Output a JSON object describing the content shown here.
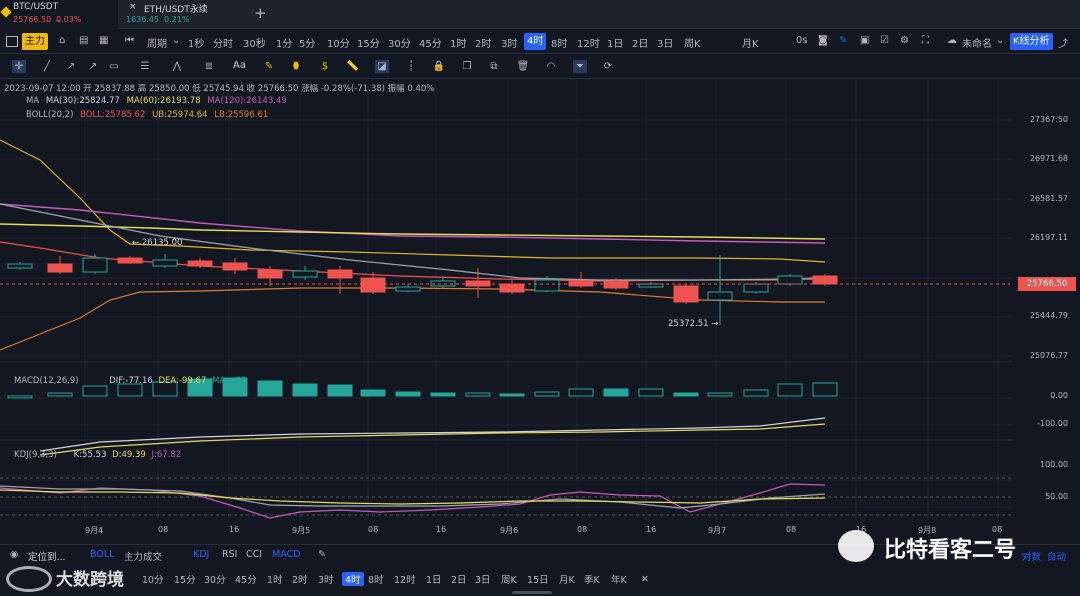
{
  "tabs": [
    {
      "symbol": "BTC/USDT",
      "price": "25766.50",
      "change": "0.03%"
    },
    {
      "symbol": "ETH/USDT永续",
      "price": "1636.45",
      "change": "0.21%"
    }
  ],
  "toolbar": {
    "main_label": "主力",
    "period_label": "周期",
    "intervals": [
      "1秒",
      "分时",
      "30秒",
      "1分",
      "5分",
      "10分",
      "15分",
      "30分",
      "45分",
      "1时",
      "2时",
      "3时",
      "4时",
      "8时",
      "12时",
      "1日",
      "2日",
      "3日",
      "周K",
      "月K"
    ],
    "active_interval": "4时",
    "zero_s": "0s",
    "unnamed": "未命名",
    "kline_btn": "K线分析"
  },
  "draw_tools": {
    "text_tool": "Aa"
  },
  "ohlc_line": "2023-09-07 12:00  开 25837.88  高 25850.00  低 25745.94  收 25766.50  涨幅 -0.28%(-71.38)  振幅 0.40%",
  "ma_legend": {
    "label": "MA",
    "ma30": "MA(30):25824.77",
    "ma60": "MA(60):26193.78",
    "ma120": "MA(120):26143.49"
  },
  "boll_legend": {
    "label": "BOLL(20,2)",
    "mid": "BOLL:25785.62",
    "ub": "UB:25974.64",
    "lb": "LB:25596.61"
  },
  "price_axis": [
    "27367.50",
    "26971.68",
    "26581.57",
    "26197.11",
    "25766.50",
    "25444.79",
    "25076.77"
  ],
  "current_price": "25766.50",
  "high_marker": "← 26135.00",
  "low_marker": "25372.51 →",
  "macd_legend": {
    "label": "MACD(12,26,9)",
    "dif": "DIF:-77.16",
    "dea": "DEA:-99.67",
    "macd_tail": "MA",
    "macd_value": "02"
  },
  "macd_axis": [
    "0.00",
    "-100.00"
  ],
  "kdj_legend": {
    "label": "KDJ(9,3,3)",
    "k": "K:55.53",
    "d": "D:49.39",
    "j": "J:67.82"
  },
  "kdj_axis": [
    "100.00",
    "50.00"
  ],
  "x_axis": [
    "9月4",
    "08",
    "16",
    "9月5",
    "08",
    "16",
    "9月6",
    "08",
    "16",
    "9月7",
    "08",
    "16",
    "9月8",
    "08"
  ],
  "bottom": {
    "locate": "定位到...",
    "boll": "BOLL",
    "main": "主力成交",
    "kdj": "KDJ",
    "rsi": "RSI",
    "cci": "CCI",
    "macd": "MACD",
    "intervals": [
      "10分",
      "15分",
      "30分",
      "45分",
      "1时",
      "2时",
      "3时",
      "4时",
      "8时",
      "12时",
      "1日",
      "2日",
      "3日",
      "周K",
      "15日",
      "月K",
      "季K",
      "年K"
    ],
    "active": "4时",
    "log": "对数",
    "auto": "自动"
  },
  "watermarks": {
    "left": "大数跨境",
    "right": "比特看客二号"
  },
  "colors": {
    "up": "#26a69a",
    "down": "#ef5350",
    "accent": "#2962ff"
  }
}
